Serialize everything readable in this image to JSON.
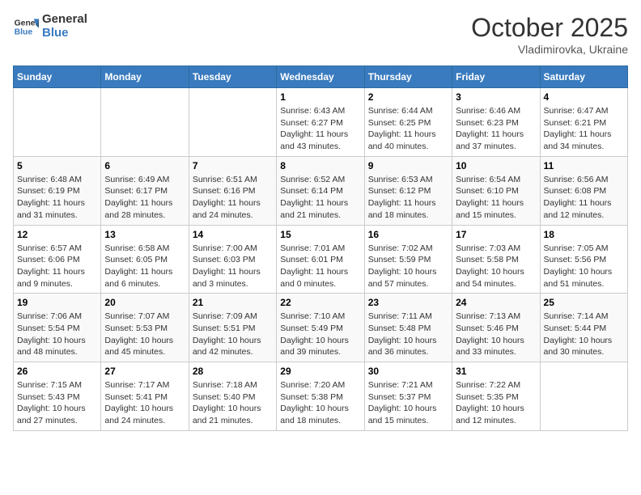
{
  "header": {
    "logo_line1": "General",
    "logo_line2": "Blue",
    "month": "October 2025",
    "location": "Vladimirovka, Ukraine"
  },
  "weekdays": [
    "Sunday",
    "Monday",
    "Tuesday",
    "Wednesday",
    "Thursday",
    "Friday",
    "Saturday"
  ],
  "weeks": [
    [
      {
        "day": "",
        "info": ""
      },
      {
        "day": "",
        "info": ""
      },
      {
        "day": "",
        "info": ""
      },
      {
        "day": "1",
        "info": "Sunrise: 6:43 AM\nSunset: 6:27 PM\nDaylight: 11 hours\nand 43 minutes."
      },
      {
        "day": "2",
        "info": "Sunrise: 6:44 AM\nSunset: 6:25 PM\nDaylight: 11 hours\nand 40 minutes."
      },
      {
        "day": "3",
        "info": "Sunrise: 6:46 AM\nSunset: 6:23 PM\nDaylight: 11 hours\nand 37 minutes."
      },
      {
        "day": "4",
        "info": "Sunrise: 6:47 AM\nSunset: 6:21 PM\nDaylight: 11 hours\nand 34 minutes."
      }
    ],
    [
      {
        "day": "5",
        "info": "Sunrise: 6:48 AM\nSunset: 6:19 PM\nDaylight: 11 hours\nand 31 minutes."
      },
      {
        "day": "6",
        "info": "Sunrise: 6:49 AM\nSunset: 6:17 PM\nDaylight: 11 hours\nand 28 minutes."
      },
      {
        "day": "7",
        "info": "Sunrise: 6:51 AM\nSunset: 6:16 PM\nDaylight: 11 hours\nand 24 minutes."
      },
      {
        "day": "8",
        "info": "Sunrise: 6:52 AM\nSunset: 6:14 PM\nDaylight: 11 hours\nand 21 minutes."
      },
      {
        "day": "9",
        "info": "Sunrise: 6:53 AM\nSunset: 6:12 PM\nDaylight: 11 hours\nand 18 minutes."
      },
      {
        "day": "10",
        "info": "Sunrise: 6:54 AM\nSunset: 6:10 PM\nDaylight: 11 hours\nand 15 minutes."
      },
      {
        "day": "11",
        "info": "Sunrise: 6:56 AM\nSunset: 6:08 PM\nDaylight: 11 hours\nand 12 minutes."
      }
    ],
    [
      {
        "day": "12",
        "info": "Sunrise: 6:57 AM\nSunset: 6:06 PM\nDaylight: 11 hours\nand 9 minutes."
      },
      {
        "day": "13",
        "info": "Sunrise: 6:58 AM\nSunset: 6:05 PM\nDaylight: 11 hours\nand 6 minutes."
      },
      {
        "day": "14",
        "info": "Sunrise: 7:00 AM\nSunset: 6:03 PM\nDaylight: 11 hours\nand 3 minutes."
      },
      {
        "day": "15",
        "info": "Sunrise: 7:01 AM\nSunset: 6:01 PM\nDaylight: 11 hours\nand 0 minutes."
      },
      {
        "day": "16",
        "info": "Sunrise: 7:02 AM\nSunset: 5:59 PM\nDaylight: 10 hours\nand 57 minutes."
      },
      {
        "day": "17",
        "info": "Sunrise: 7:03 AM\nSunset: 5:58 PM\nDaylight: 10 hours\nand 54 minutes."
      },
      {
        "day": "18",
        "info": "Sunrise: 7:05 AM\nSunset: 5:56 PM\nDaylight: 10 hours\nand 51 minutes."
      }
    ],
    [
      {
        "day": "19",
        "info": "Sunrise: 7:06 AM\nSunset: 5:54 PM\nDaylight: 10 hours\nand 48 minutes."
      },
      {
        "day": "20",
        "info": "Sunrise: 7:07 AM\nSunset: 5:53 PM\nDaylight: 10 hours\nand 45 minutes."
      },
      {
        "day": "21",
        "info": "Sunrise: 7:09 AM\nSunset: 5:51 PM\nDaylight: 10 hours\nand 42 minutes."
      },
      {
        "day": "22",
        "info": "Sunrise: 7:10 AM\nSunset: 5:49 PM\nDaylight: 10 hours\nand 39 minutes."
      },
      {
        "day": "23",
        "info": "Sunrise: 7:11 AM\nSunset: 5:48 PM\nDaylight: 10 hours\nand 36 minutes."
      },
      {
        "day": "24",
        "info": "Sunrise: 7:13 AM\nSunset: 5:46 PM\nDaylight: 10 hours\nand 33 minutes."
      },
      {
        "day": "25",
        "info": "Sunrise: 7:14 AM\nSunset: 5:44 PM\nDaylight: 10 hours\nand 30 minutes."
      }
    ],
    [
      {
        "day": "26",
        "info": "Sunrise: 7:15 AM\nSunset: 5:43 PM\nDaylight: 10 hours\nand 27 minutes."
      },
      {
        "day": "27",
        "info": "Sunrise: 7:17 AM\nSunset: 5:41 PM\nDaylight: 10 hours\nand 24 minutes."
      },
      {
        "day": "28",
        "info": "Sunrise: 7:18 AM\nSunset: 5:40 PM\nDaylight: 10 hours\nand 21 minutes."
      },
      {
        "day": "29",
        "info": "Sunrise: 7:20 AM\nSunset: 5:38 PM\nDaylight: 10 hours\nand 18 minutes."
      },
      {
        "day": "30",
        "info": "Sunrise: 7:21 AM\nSunset: 5:37 PM\nDaylight: 10 hours\nand 15 minutes."
      },
      {
        "day": "31",
        "info": "Sunrise: 7:22 AM\nSunset: 5:35 PM\nDaylight: 10 hours\nand 12 minutes."
      },
      {
        "day": "",
        "info": ""
      }
    ]
  ]
}
